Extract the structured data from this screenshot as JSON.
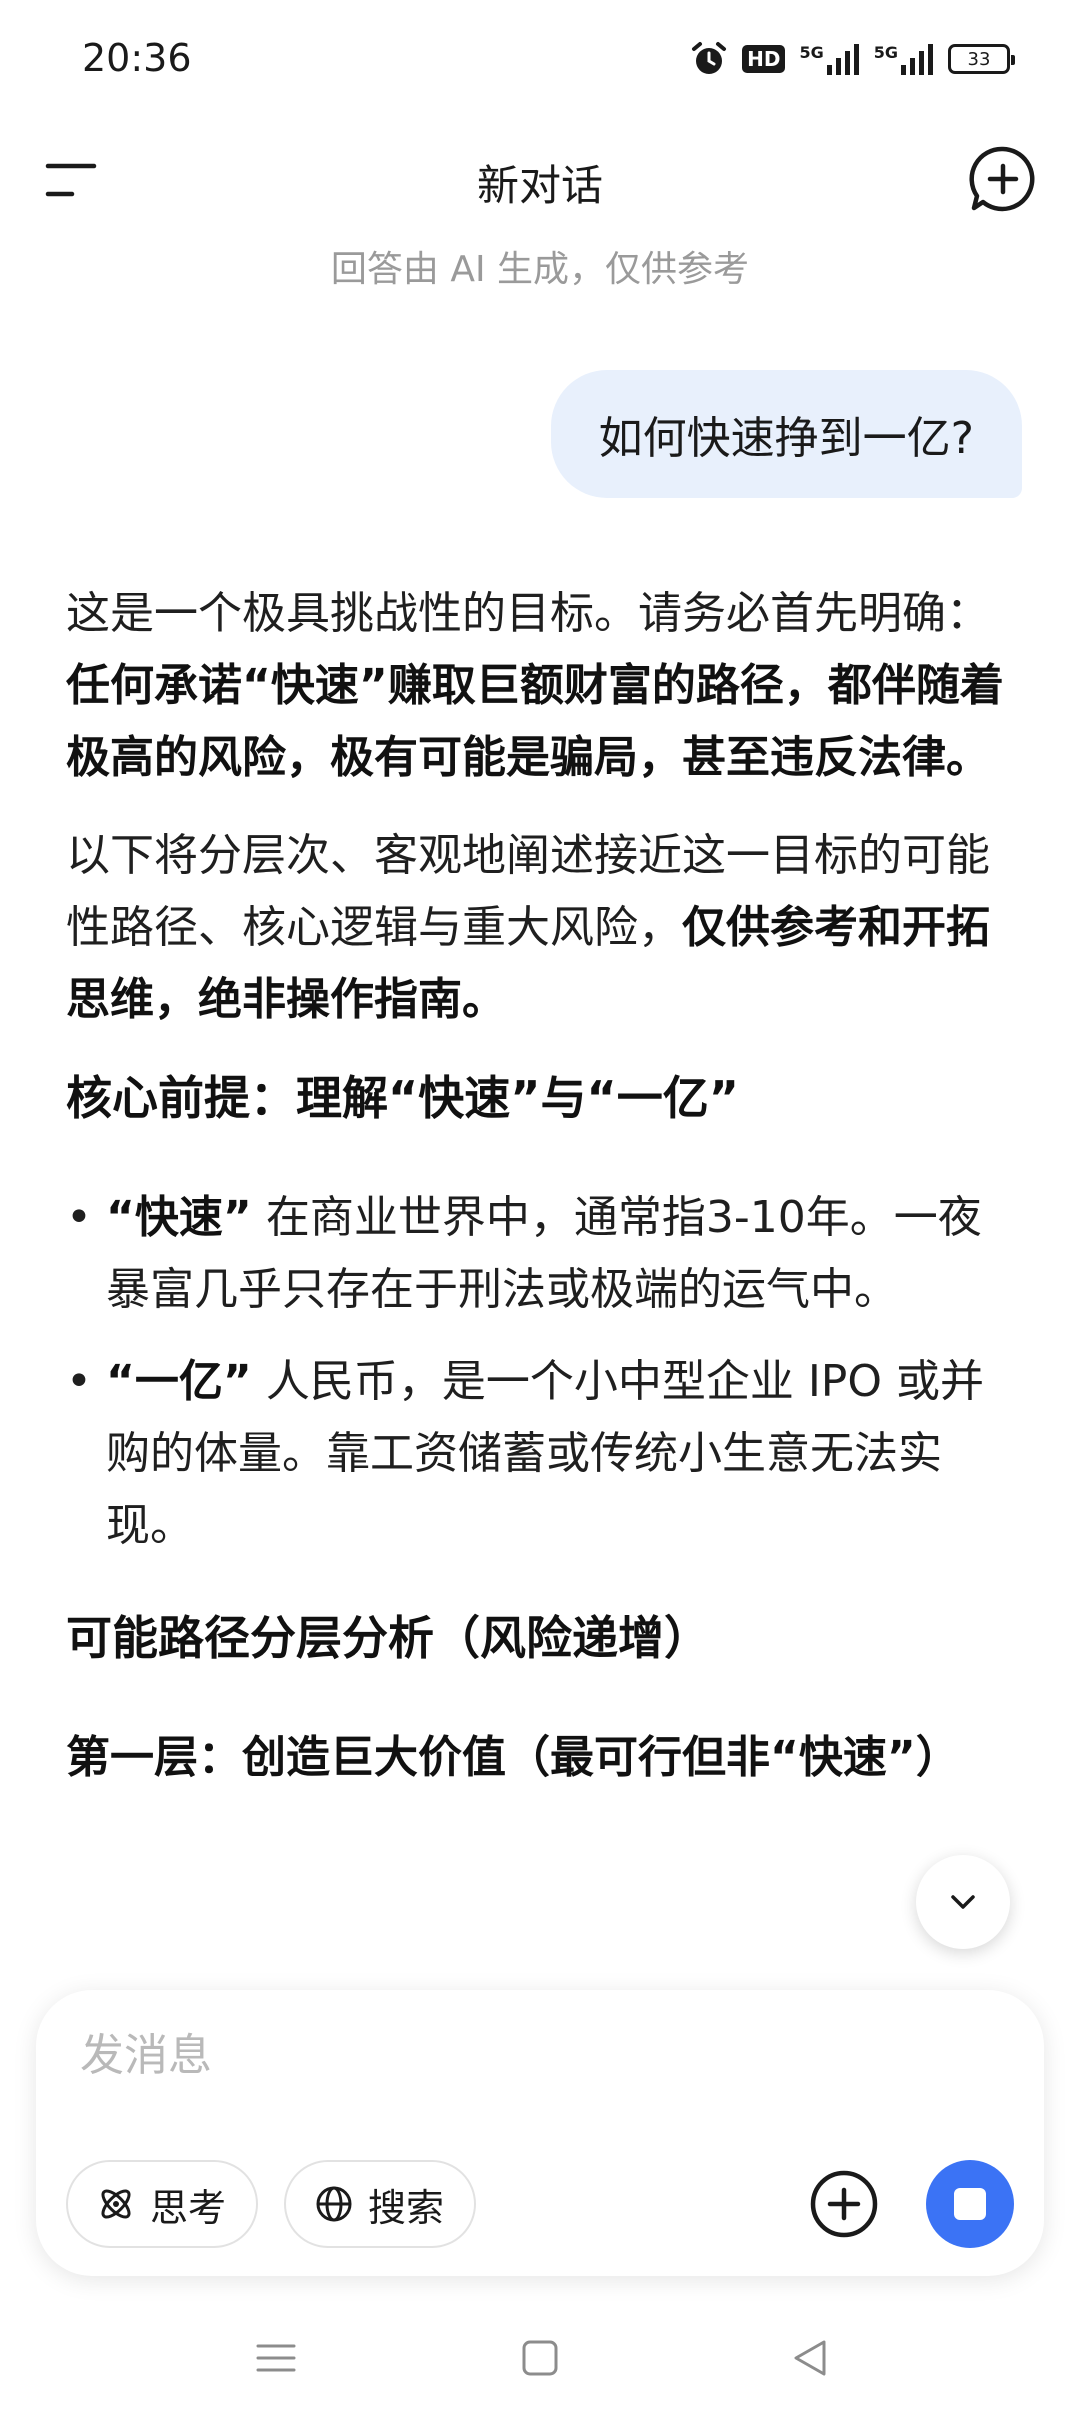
{
  "status_bar": {
    "time": "20:36",
    "hd_label": "HD",
    "signal1_label": "5G",
    "signal2_label": "5G",
    "battery": "33"
  },
  "header": {
    "title": "新对话",
    "disclaimer": "回答由 AI 生成，仅供参考"
  },
  "chat": {
    "user_message": "如何快速挣到一亿?",
    "answer": {
      "p1_normal": "这是一个极具挑战性的目标。请务必首先明确：",
      "p1_bold": "任何承诺“快速”赚取巨额财富的路径，都伴随着极高的风险，极有可能是骗局，甚至违反法律。",
      "p2_normal": "以下将分层次、客观地阐述接近这一目标的可能性路径、核心逻辑与重大风险，",
      "p2_bold": "仅供参考和开拓思维，绝非操作指南。",
      "h1": "核心前提：理解“快速”与“一亿”",
      "bullets": [
        {
          "bold": "“快速”",
          "text": " 在商业世界中，通常指3-10年。一夜暴富几乎只存在于刑法或极端的运气中。"
        },
        {
          "bold": "“一亿”",
          "text": " 人民币，是一个小中型企业 IPO 或并购的体量。靠工资储蓄或传统小生意无法实现。"
        }
      ],
      "h2": "可能路径分层分析（风险递增）",
      "layer1": "第一层：创造巨大价值（最可行但非“快速”）"
    }
  },
  "composer": {
    "placeholder": "发消息",
    "think_label": "思考",
    "search_label": "搜索"
  },
  "colors": {
    "accent": "#3b73f5",
    "user_bubble": "#e8f0fc",
    "muted_text": "#9a9a9a"
  },
  "icons": [
    "alarm-icon",
    "menu-icon",
    "new-chat-icon",
    "chevron-down-icon",
    "atom-icon",
    "globe-icon",
    "plus-circle-icon",
    "stop-icon",
    "nav-menu-icon",
    "nav-home-icon",
    "nav-back-icon"
  ]
}
